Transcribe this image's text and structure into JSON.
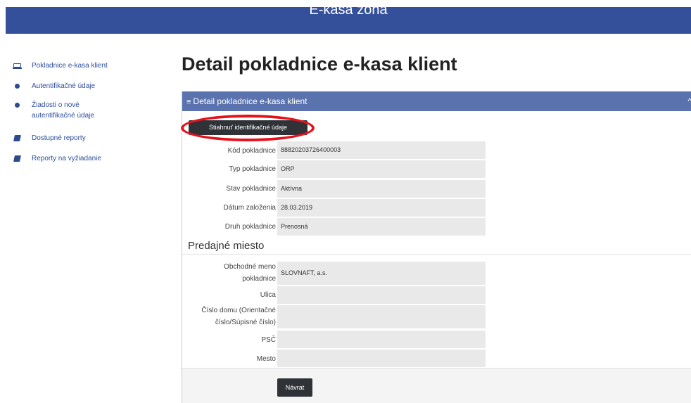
{
  "app": {
    "title": "E-kasa zóna"
  },
  "sidebar": {
    "items": [
      {
        "label": "Pokladnice e-kasa klient",
        "icon": "laptop-icon"
      },
      {
        "label": "Autentifikačné údaje",
        "icon": "dot-icon"
      },
      {
        "label": "Žiadosti o nové autentifikačné údaje",
        "icon": "dot-icon"
      },
      {
        "label": "Dostupné reporty",
        "icon": "book-icon"
      },
      {
        "label": "Reporty na vyžiadanie",
        "icon": "book-icon"
      }
    ]
  },
  "main": {
    "page_title": "Detail pokladnice e-kasa klient",
    "panel": {
      "title": "Detail pokladnice e-kasa klient",
      "menu_icon": "≡",
      "collapse_icon": "^",
      "download_button": "Stiahnuť identifikačné údaje",
      "fields": [
        {
          "label": "Kód pokladnice",
          "value": "88820203726400003"
        },
        {
          "label": "Typ pokladnice",
          "value": "ORP"
        },
        {
          "label": "Stav pokladnice",
          "value": "Aktívna"
        },
        {
          "label": "Dátum založenia",
          "value": "28.03.2019"
        },
        {
          "label": "Druh pokladnice",
          "value": "Prenosná"
        }
      ],
      "section_title": "Predajné miesto",
      "place_fields": [
        {
          "label": "Obchodné meno pokladnice",
          "value": "SLOVNAFT, a.s."
        },
        {
          "label": "Ulica",
          "value": ""
        },
        {
          "label": "Číslo domu (Orientačné číslo/Súpisné číslo)",
          "value": ""
        },
        {
          "label": "PSČ",
          "value": ""
        },
        {
          "label": "Mesto",
          "value": ""
        }
      ],
      "back_button": "Návrat"
    }
  },
  "colors": {
    "top_bar": "#34509a",
    "panel_header": "#5a72ad",
    "link": "#2d4d9b",
    "button_dark": "#2f3338",
    "highlight": "#e5121b"
  }
}
